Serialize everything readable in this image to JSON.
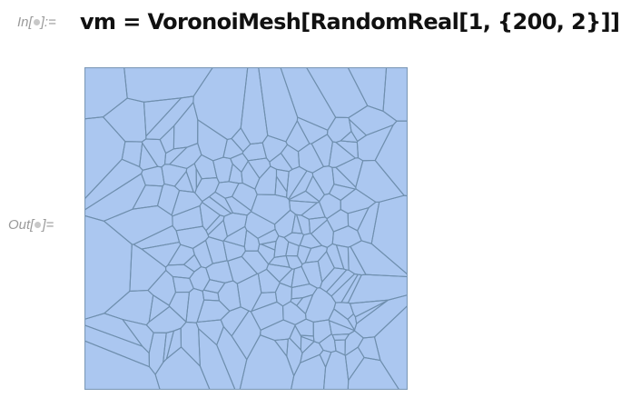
{
  "input": {
    "label_prefix": "In[",
    "label_suffix": "]:=",
    "code": "vm = VoronoiMesh[RandomReal[1, {200, 2}]]"
  },
  "output": {
    "label_prefix": "Out[",
    "label_suffix": "]=",
    "mesh": {
      "description_type": "voronoi-mesh",
      "cell_count": 200,
      "fill_color": "#abc7f0",
      "edge_color": "#6f8fae"
    }
  }
}
